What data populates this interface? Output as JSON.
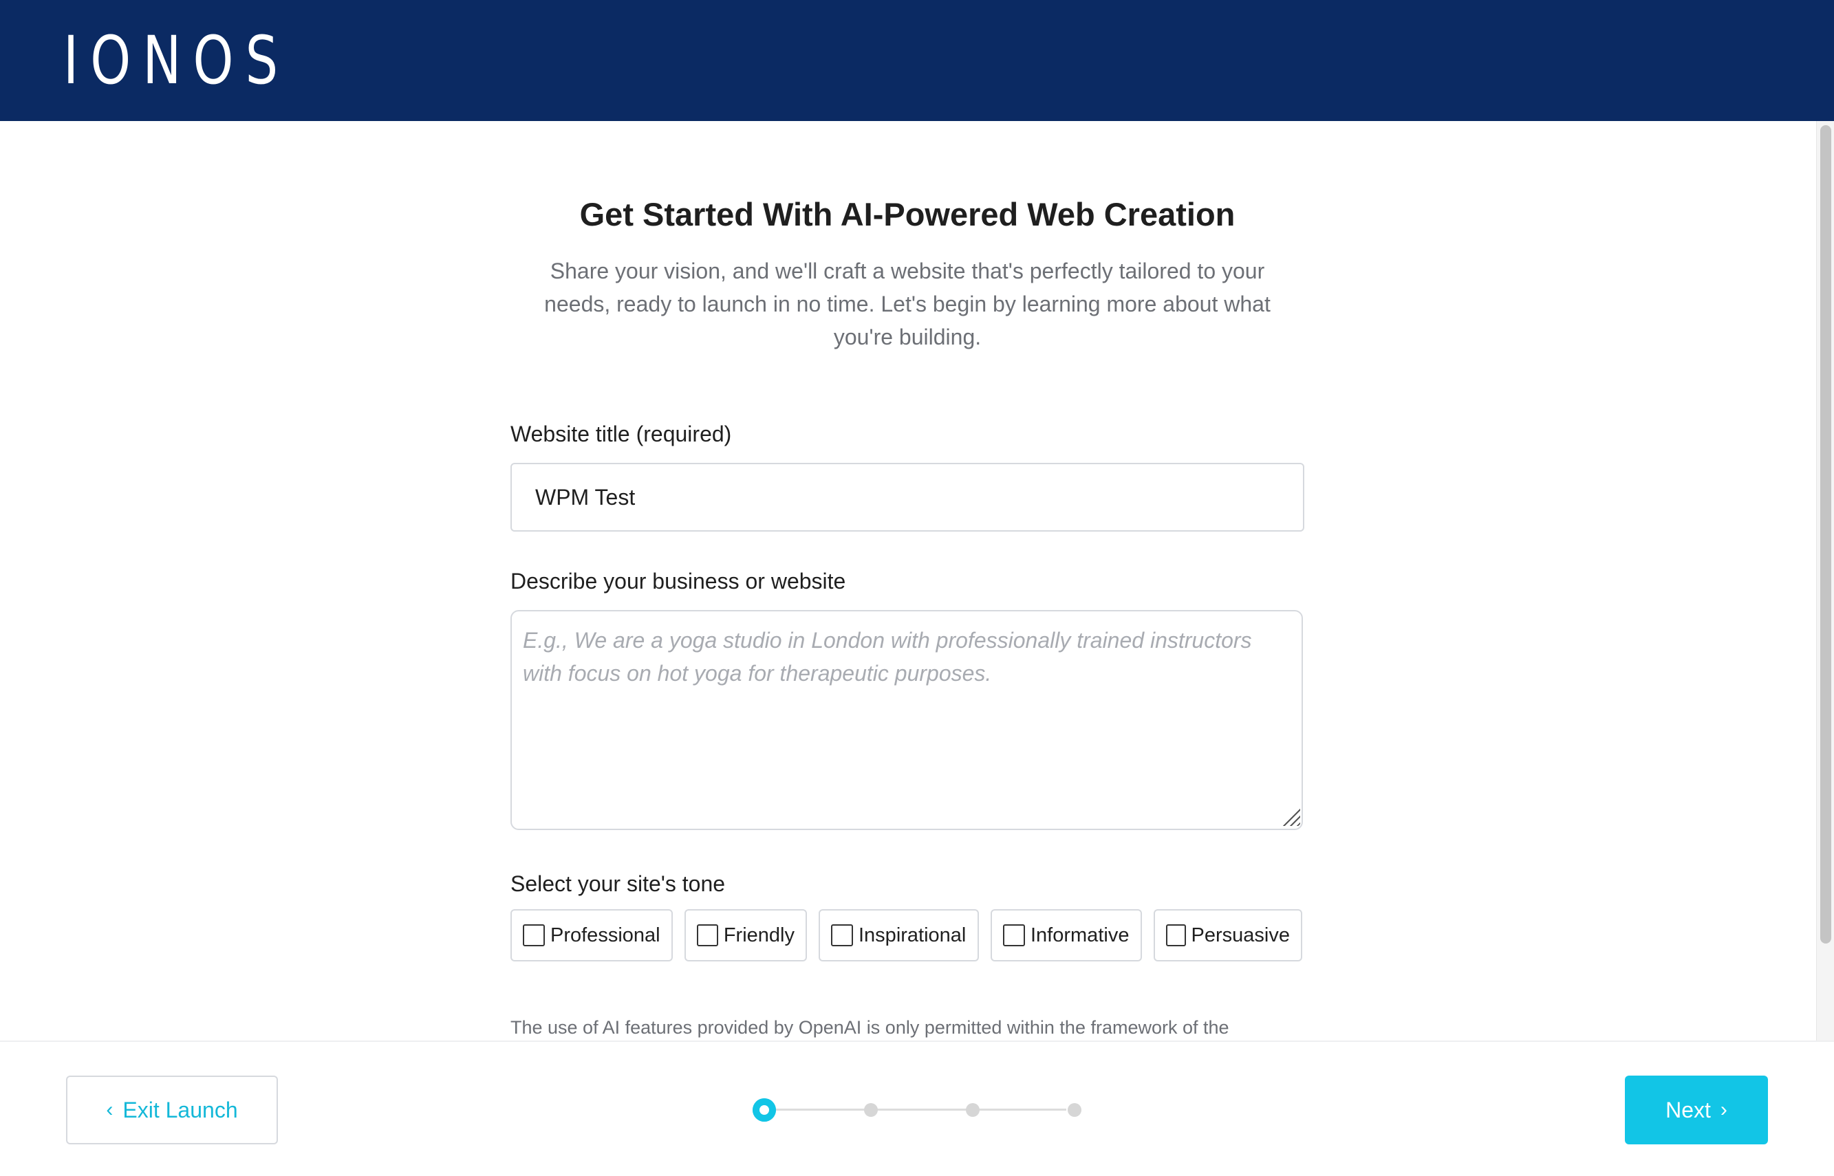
{
  "header": {
    "logo": "IONOS"
  },
  "intro": {
    "title": "Get Started With AI-Powered Web Creation",
    "subtitle": "Share your vision, and we'll craft a website that's perfectly tailored to your needs, ready to launch in no time. Let's begin by learning more about what you're building."
  },
  "form": {
    "title_label": "Website title (required)",
    "title_value": "WPM Test",
    "description_label": "Describe your business or website",
    "description_placeholder": "E.g., We are a yoga studio in London with professionally trained instructors with focus on hot yoga for therapeutic purposes.",
    "tone_label": "Select your site's tone",
    "tones": [
      {
        "label": "Professional",
        "checked": false
      },
      {
        "label": "Friendly",
        "checked": false
      },
      {
        "label": "Inspirational",
        "checked": false
      },
      {
        "label": "Informative",
        "checked": false
      },
      {
        "label": "Persuasive",
        "checked": false
      }
    ],
    "disclaimer": "The use of AI features provided by OpenAI is only permitted within the framework of the"
  },
  "footer": {
    "exit_label": "Exit Launch",
    "next_label": "Next",
    "steps_total": 4,
    "current_step": 1
  },
  "colors": {
    "header_bg": "#0b2a63",
    "accent": "#12c5e6"
  }
}
